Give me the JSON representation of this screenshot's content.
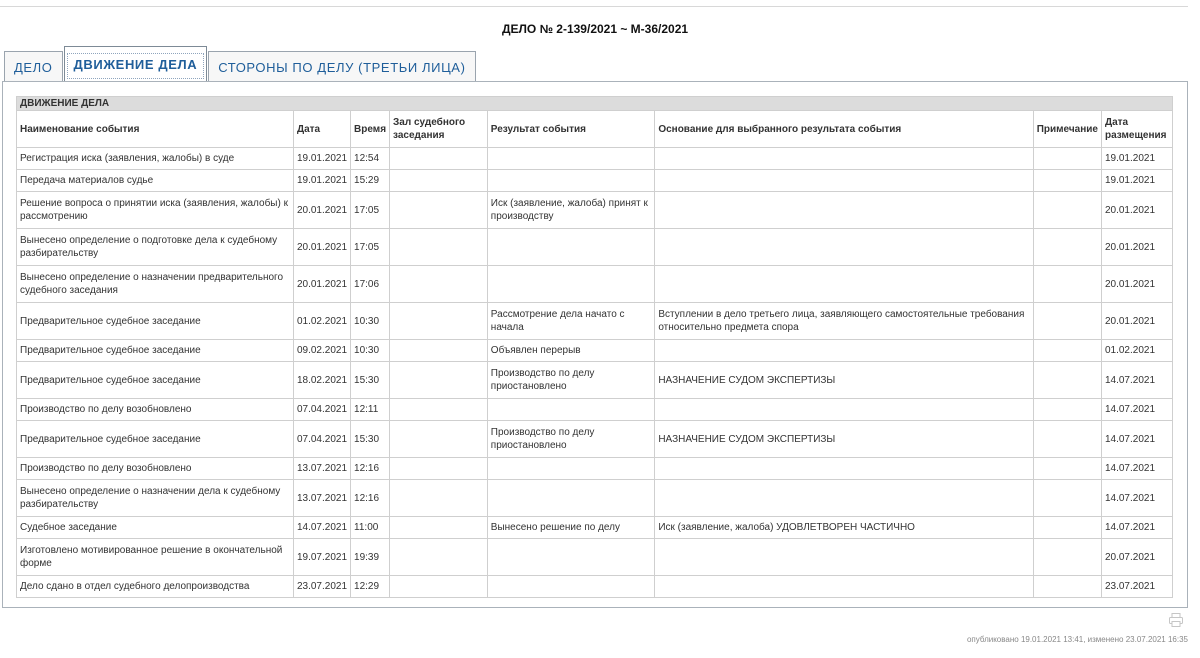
{
  "case_title": "ДЕЛО № 2-139/2021 ~ М-36/2021",
  "tabs": [
    {
      "label": "ДЕЛО"
    },
    {
      "label": "ДВИЖЕНИЕ ДЕЛА"
    },
    {
      "label": "СТОРОНЫ ПО ДЕЛУ (ТРЕТЬИ ЛИЦА)"
    }
  ],
  "section_title": "ДВИЖЕНИЕ ДЕЛА",
  "columns": {
    "name": "Наименование события",
    "date": "Дата",
    "time": "Время",
    "room": "Зал судебного заседания",
    "result": "Результат события",
    "basis": "Основание для выбранного результата события",
    "note": "Примечание",
    "posted": "Дата размещения"
  },
  "rows": [
    {
      "name": "Регистрация иска (заявления, жалобы) в суде",
      "date": "19.01.2021",
      "time": "12:54",
      "room": "",
      "result": "",
      "basis": "",
      "note": "",
      "posted": "19.01.2021"
    },
    {
      "name": "Передача материалов судье",
      "date": "19.01.2021",
      "time": "15:29",
      "room": "",
      "result": "",
      "basis": "",
      "note": "",
      "posted": "19.01.2021"
    },
    {
      "name": "Решение вопроса о принятии иска (заявления, жалобы) к рассмотрению",
      "date": "20.01.2021",
      "time": "17:05",
      "room": "",
      "result": "Иск (заявление, жалоба) принят к производству",
      "basis": "",
      "note": "",
      "posted": "20.01.2021"
    },
    {
      "name": "Вынесено определение о подготовке дела к судебному разбирательству",
      "date": "20.01.2021",
      "time": "17:05",
      "room": "",
      "result": "",
      "basis": "",
      "note": "",
      "posted": "20.01.2021"
    },
    {
      "name": "Вынесено определение о назначении предварительного судебного заседания",
      "date": "20.01.2021",
      "time": "17:06",
      "room": "",
      "result": "",
      "basis": "",
      "note": "",
      "posted": "20.01.2021"
    },
    {
      "name": "Предварительное судебное заседание",
      "date": "01.02.2021",
      "time": "10:30",
      "room": "",
      "result": "Рассмотрение дела начато с начала",
      "basis": "Вступлении в дело третьего лица, заявляющего самостоятельные требования относительно предмета спора",
      "note": "",
      "posted": "20.01.2021"
    },
    {
      "name": "Предварительное судебное заседание",
      "date": "09.02.2021",
      "time": "10:30",
      "room": "",
      "result": "Объявлен перерыв",
      "basis": "",
      "note": "",
      "posted": "01.02.2021"
    },
    {
      "name": "Предварительное судебное заседание",
      "date": "18.02.2021",
      "time": "15:30",
      "room": "",
      "result": "Производство по делу приостановлено",
      "basis": "НАЗНАЧЕНИЕ СУДОМ ЭКСПЕРТИЗЫ",
      "note": "",
      "posted": "14.07.2021"
    },
    {
      "name": "Производство по делу возобновлено",
      "date": "07.04.2021",
      "time": "12:11",
      "room": "",
      "result": "",
      "basis": "",
      "note": "",
      "posted": "14.07.2021"
    },
    {
      "name": "Предварительное судебное заседание",
      "date": "07.04.2021",
      "time": "15:30",
      "room": "",
      "result": "Производство по делу приостановлено",
      "basis": "НАЗНАЧЕНИЕ СУДОМ ЭКСПЕРТИЗЫ",
      "note": "",
      "posted": "14.07.2021"
    },
    {
      "name": "Производство по делу возобновлено",
      "date": "13.07.2021",
      "time": "12:16",
      "room": "",
      "result": "",
      "basis": "",
      "note": "",
      "posted": "14.07.2021"
    },
    {
      "name": "Вынесено определение о назначении дела к судебному разбирательству",
      "date": "13.07.2021",
      "time": "12:16",
      "room": "",
      "result": "",
      "basis": "",
      "note": "",
      "posted": "14.07.2021"
    },
    {
      "name": "Судебное заседание",
      "date": "14.07.2021",
      "time": "11:00",
      "room": "",
      "result": "Вынесено решение по делу",
      "basis": "Иск (заявление, жалоба) УДОВЛЕТВОРЕН ЧАСТИЧНО",
      "note": "",
      "posted": "14.07.2021"
    },
    {
      "name": "Изготовлено мотивированное решение в окончательной форме",
      "date": "19.07.2021",
      "time": "19:39",
      "room": "",
      "result": "",
      "basis": "",
      "note": "",
      "posted": "20.07.2021"
    },
    {
      "name": "Дело сдано в отдел судебного делопроизводства",
      "date": "23.07.2021",
      "time": "12:29",
      "room": "",
      "result": "",
      "basis": "",
      "note": "",
      "posted": "23.07.2021"
    }
  ],
  "icons": {
    "print": "printer-icon"
  },
  "footer": "опубликовано 19.01.2021 13:41, изменено 23.07.2021 16:35"
}
